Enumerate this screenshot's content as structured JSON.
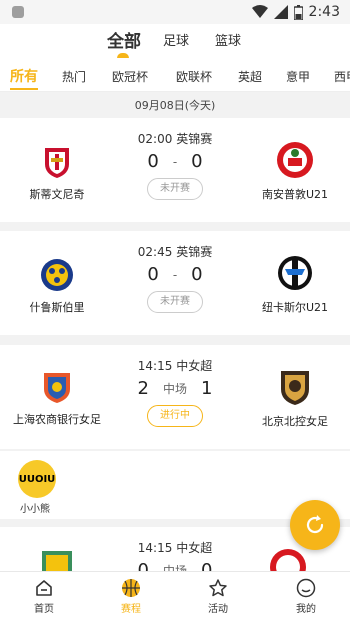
{
  "status_bar": {
    "time": "2:43"
  },
  "top_tabs": [
    "全部",
    "足球",
    "篮球"
  ],
  "categories": [
    "所有",
    "热门",
    "欧冠杯",
    "欧联杯",
    "英超",
    "意甲",
    "西甲"
  ],
  "date_label": "09月08日(今天)",
  "matches": [
    {
      "time": "02:00",
      "league": "英锦赛",
      "home": "斯蒂文尼奇",
      "away": "南安普敦U21",
      "home_score": "0",
      "away_score": "0",
      "sep": "-",
      "status": "未开赛",
      "live": false
    },
    {
      "time": "02:45",
      "league": "英锦赛",
      "home": "什鲁斯伯里",
      "away": "纽卡斯尔U21",
      "home_score": "0",
      "away_score": "0",
      "sep": "-",
      "status": "未开赛",
      "live": false
    },
    {
      "time": "14:15",
      "league": "中女超",
      "home": "上海农商银行女足",
      "away": "北京北控女足",
      "home_score": "2",
      "away_score": "1",
      "sep": "中场",
      "status": "进行中",
      "live": true
    },
    {
      "time": "14:15",
      "league": "中女超",
      "home_score": "0",
      "away_score": "0",
      "sep": "中场"
    }
  ],
  "ad": {
    "badge_text": "UUOIU",
    "name": "小小熊"
  },
  "bottom_nav": [
    "首页",
    "赛程",
    "活动",
    "我的"
  ],
  "colors": {
    "accent": "#f6b519",
    "background": "#f2f2f2"
  }
}
